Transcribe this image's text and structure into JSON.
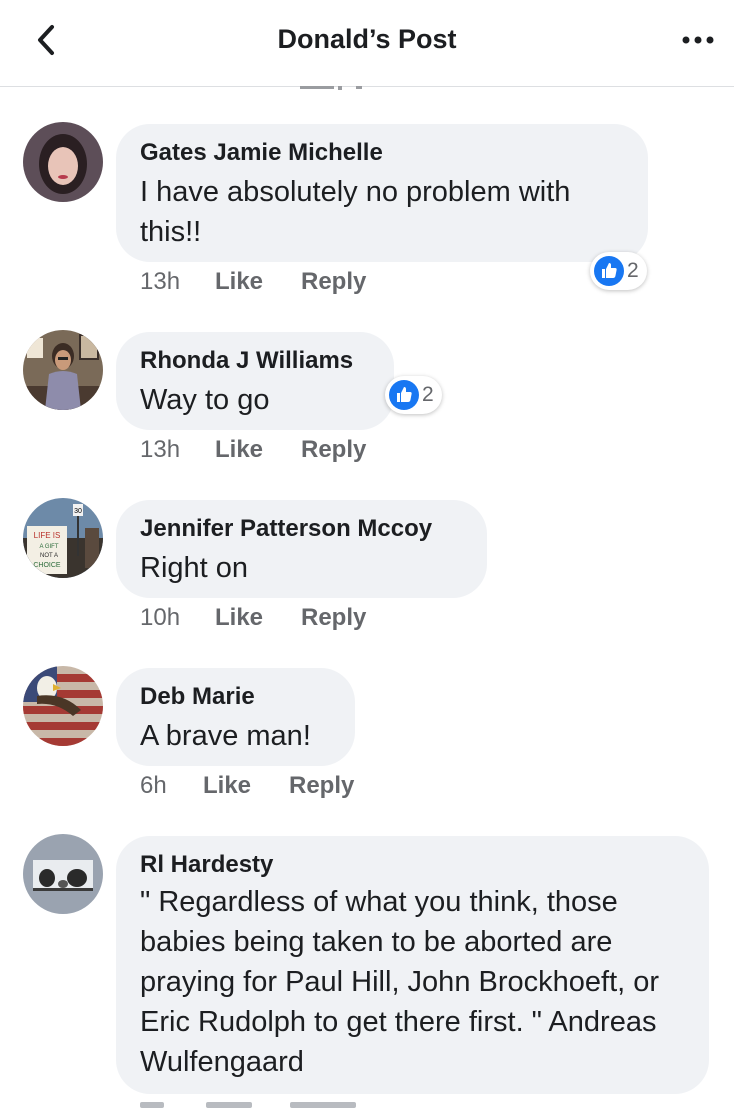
{
  "header": {
    "title": "Donald’s Post"
  },
  "comments": [
    {
      "name": "Gates Jamie Michelle",
      "text": "I have absolutely no problem with this!!",
      "time": "13h",
      "like": "Like",
      "reply": "Reply",
      "reactions": "2"
    },
    {
      "name": "Rhonda J Williams",
      "text": "Way to go",
      "time": "13h",
      "like": "Like",
      "reply": "Reply",
      "reactions": "2"
    },
    {
      "name": "Jennifer Patterson Mccoy",
      "text": "Right on",
      "time": "10h",
      "like": "Like",
      "reply": "Reply"
    },
    {
      "name": "Deb Marie",
      "text": "A brave man!",
      "time": "6h",
      "like": "Like",
      "reply": "Reply"
    },
    {
      "name": "Rl Hardesty",
      "text": "\" Regardless of what you think, those babies being taken to be aborted are praying for Paul Hill, John Brockhoeft, or Eric Rudolph to get there first. \" Andreas Wulfengaard"
    }
  ],
  "avatar_signs": {
    "sign_1": "LIFE IS",
    "sign_2": "A GIFT",
    "sign_3": "NOT A",
    "sign_4": "CHOICE",
    "route": "30"
  },
  "colors": {
    "reaction_blue": "#1877f2",
    "bubble_bg": "#f0f2f5",
    "meta_gray": "#65676b"
  },
  "icons": {
    "back": "chevron-left-icon",
    "more": "more-horizontal-icon",
    "like_reaction": "thumbs-up-icon"
  }
}
